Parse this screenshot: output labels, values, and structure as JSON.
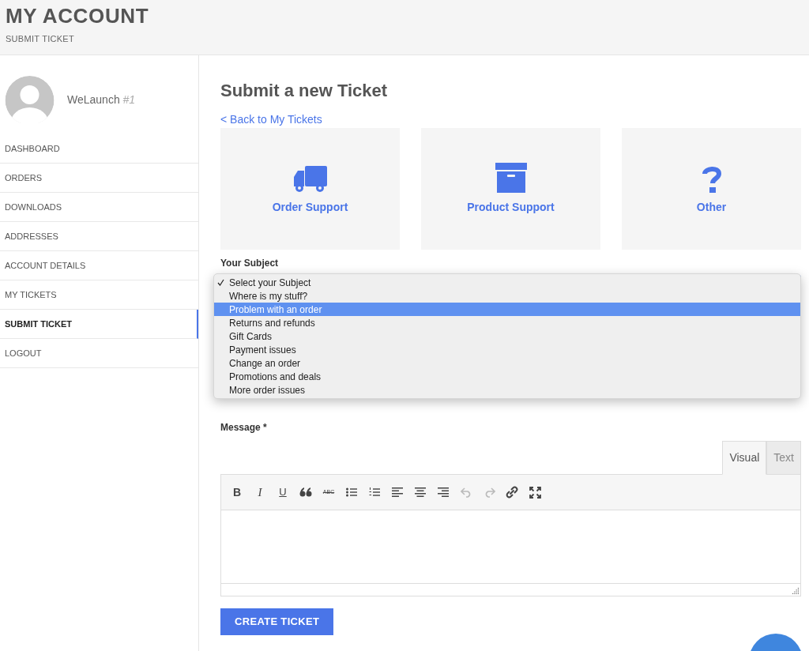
{
  "header": {
    "title": "MY ACCOUNT",
    "breadcrumb": "SUBMIT TICKET"
  },
  "user": {
    "name": "WeLaunch",
    "number": "#1"
  },
  "sidebar": {
    "items": [
      {
        "label": "DASHBOARD",
        "selected": false
      },
      {
        "label": "ORDERS",
        "selected": false
      },
      {
        "label": "DOWNLOADS",
        "selected": false
      },
      {
        "label": "ADDRESSES",
        "selected": false
      },
      {
        "label": "ACCOUNT DETAILS",
        "selected": false
      },
      {
        "label": "MY TICKETS",
        "selected": false
      },
      {
        "label": "SUBMIT TICKET",
        "selected": true
      },
      {
        "label": "LOGOUT",
        "selected": false
      }
    ]
  },
  "main": {
    "title": "Submit a new Ticket",
    "back_link": "< Back to My Tickets",
    "categories": [
      {
        "kind": "truck",
        "label": "Order Support"
      },
      {
        "kind": "box",
        "label": "Product Support"
      },
      {
        "kind": "question",
        "label": "Other"
      }
    ],
    "subject": {
      "label": "Your Subject",
      "options": [
        {
          "label": "Select your Subject",
          "checked": true,
          "highlighted": false
        },
        {
          "label": "Where is my stuff?",
          "checked": false,
          "highlighted": false
        },
        {
          "label": "Problem with an order",
          "checked": false,
          "highlighted": true
        },
        {
          "label": "Returns and refunds",
          "checked": false,
          "highlighted": false
        },
        {
          "label": "Gift Cards",
          "checked": false,
          "highlighted": false
        },
        {
          "label": "Payment issues",
          "checked": false,
          "highlighted": false
        },
        {
          "label": "Change an order",
          "checked": false,
          "highlighted": false
        },
        {
          "label": "Promotions and deals",
          "checked": false,
          "highlighted": false
        },
        {
          "label": "More order issues",
          "checked": false,
          "highlighted": false
        }
      ]
    },
    "message": {
      "label": "Message *",
      "tabs": [
        {
          "label": "Visual",
          "selected": true
        },
        {
          "label": "Text",
          "selected": false
        }
      ],
      "tools": [
        {
          "kind": "bold",
          "label": "B",
          "disabled": false
        },
        {
          "kind": "italic",
          "label": "I",
          "disabled": false
        },
        {
          "kind": "underline",
          "label": "U",
          "disabled": false
        },
        {
          "kind": "quote",
          "disabled": false
        },
        {
          "kind": "strike",
          "label": "ABC",
          "disabled": false
        },
        {
          "kind": "bullets",
          "disabled": false
        },
        {
          "kind": "numbers",
          "disabled": false
        },
        {
          "kind": "align-left",
          "disabled": false
        },
        {
          "kind": "align-center",
          "disabled": false
        },
        {
          "kind": "align-right",
          "disabled": false
        },
        {
          "kind": "undo",
          "disabled": true
        },
        {
          "kind": "redo",
          "disabled": true
        },
        {
          "kind": "link",
          "disabled": false
        },
        {
          "kind": "fullscreen",
          "disabled": false
        }
      ]
    },
    "submit": "CREATE TICKET"
  }
}
